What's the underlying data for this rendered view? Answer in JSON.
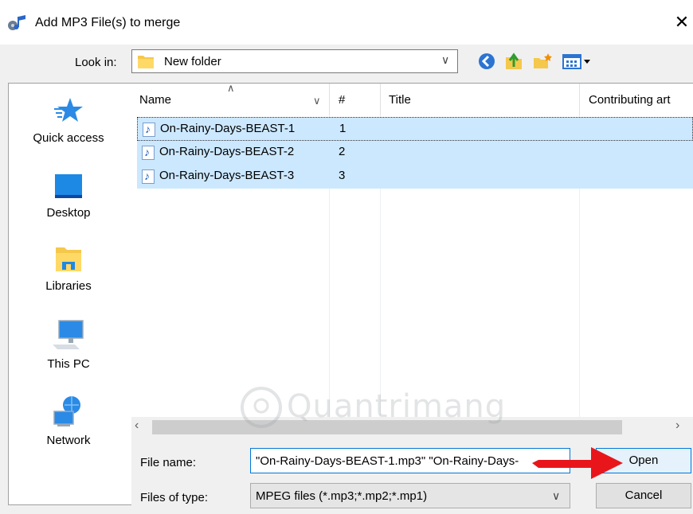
{
  "window": {
    "title": "Add MP3 File(s) to merge",
    "close_glyph": "✕"
  },
  "toolbar": {
    "look_in_label": "Look in:",
    "look_in_value": "New folder",
    "icons": [
      "back-icon",
      "up-folder-icon",
      "new-folder-icon",
      "view-menu-icon"
    ]
  },
  "sidebar": {
    "items": [
      {
        "label": "Quick access",
        "icon": "star-icon"
      },
      {
        "label": "Desktop",
        "icon": "desktop-icon"
      },
      {
        "label": "Libraries",
        "icon": "libraries-icon"
      },
      {
        "label": "This PC",
        "icon": "computer-icon"
      },
      {
        "label": "Network",
        "icon": "network-icon"
      }
    ]
  },
  "list": {
    "columns": [
      "Name",
      "#",
      "Title",
      "Contributing art"
    ],
    "rows": [
      {
        "name": "On-Rainy-Days-BEAST-1",
        "num": "1"
      },
      {
        "name": "On-Rainy-Days-BEAST-2",
        "num": "2"
      },
      {
        "name": "On-Rainy-Days-BEAST-3",
        "num": "3"
      }
    ]
  },
  "form": {
    "file_name_label": "File name:",
    "file_name_value": "\"On-Rainy-Days-BEAST-1.mp3\" \"On-Rainy-Days-",
    "file_type_label": "Files of type:",
    "file_type_value": "MPEG files (*.mp3;*.mp2;*.mp1)",
    "open_label": "Open",
    "cancel_label": "Cancel"
  },
  "colors": {
    "selection": "#cce8ff",
    "accent": "#0078d7",
    "arrow": "#e8161b"
  },
  "watermark": "Quantrimang"
}
